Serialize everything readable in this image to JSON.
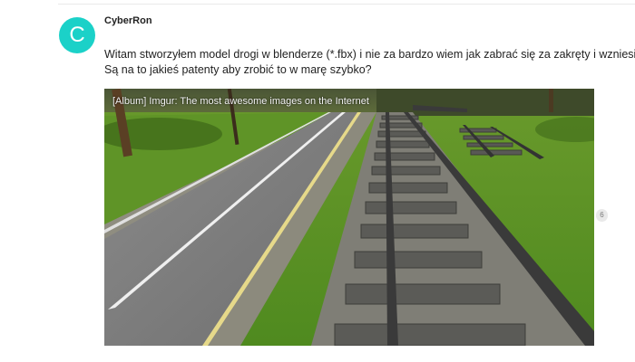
{
  "post": {
    "avatar_letter": "C",
    "avatar_color": "#1bd1c8",
    "username": "CyberRon",
    "lines": [
      "Witam stworzyłem model drogi w blenderze (*.fbx) i nie za bardzo wiem jak zabrać się za zakręty i wzniesienia.",
      "Są na to jakieś patenty aby zrobić to w marę szybko?"
    ],
    "onebox": {
      "caption": "[Album] Imgur: The most awesome images on the Internet",
      "image_subject": "road-and-railway-3d-scene"
    },
    "link_click_count": "6"
  }
}
